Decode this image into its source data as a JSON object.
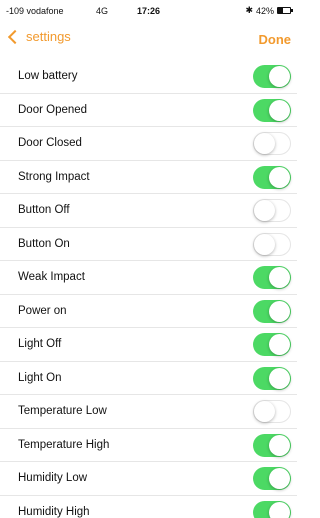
{
  "status_bar": {
    "carrier": "-109 vodafone",
    "network": "4G",
    "time": "17:26",
    "bluetooth_icon": "bluetooth-icon",
    "battery": "42%",
    "battery_level": 0.42
  },
  "nav": {
    "back_label": "settings",
    "back_icon": "chevron-left-icon",
    "done_label": "Done",
    "accent_color": "#f29a2e"
  },
  "toggle_on_color": "#4cd964",
  "settings": [
    {
      "label": "Low battery",
      "on": true
    },
    {
      "label": "Door Opened",
      "on": true
    },
    {
      "label": "Door Closed",
      "on": false
    },
    {
      "label": "Strong Impact",
      "on": true
    },
    {
      "label": "Button Off",
      "on": false
    },
    {
      "label": "Button On",
      "on": false
    },
    {
      "label": "Weak Impact",
      "on": true
    },
    {
      "label": "Power on",
      "on": true
    },
    {
      "label": "Light Off",
      "on": true
    },
    {
      "label": "Light On",
      "on": true
    },
    {
      "label": "Temperature Low",
      "on": false
    },
    {
      "label": "Temperature High",
      "on": true
    },
    {
      "label": "Humidity Low",
      "on": true
    },
    {
      "label": "Humidity High",
      "on": true
    }
  ]
}
